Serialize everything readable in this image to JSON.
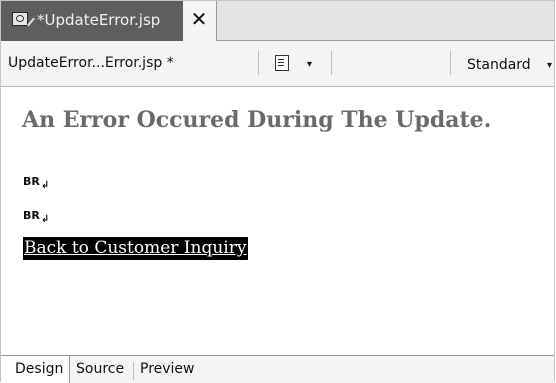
{
  "editor_tab": {
    "title": "*UpdateError.jsp",
    "close": "✕"
  },
  "toolbar": {
    "file_label": "UpdateError...Error.jsp *",
    "mode_label": "Standard",
    "arrow": "▾"
  },
  "content": {
    "heading": "An Error Occured During The Update.",
    "br_markers": [
      "BR",
      "BR"
    ],
    "br_glyph": "↲",
    "link_text": "Back to Customer Inquiry"
  },
  "bottom_tabs": [
    "Design",
    "Source",
    "Preview"
  ]
}
